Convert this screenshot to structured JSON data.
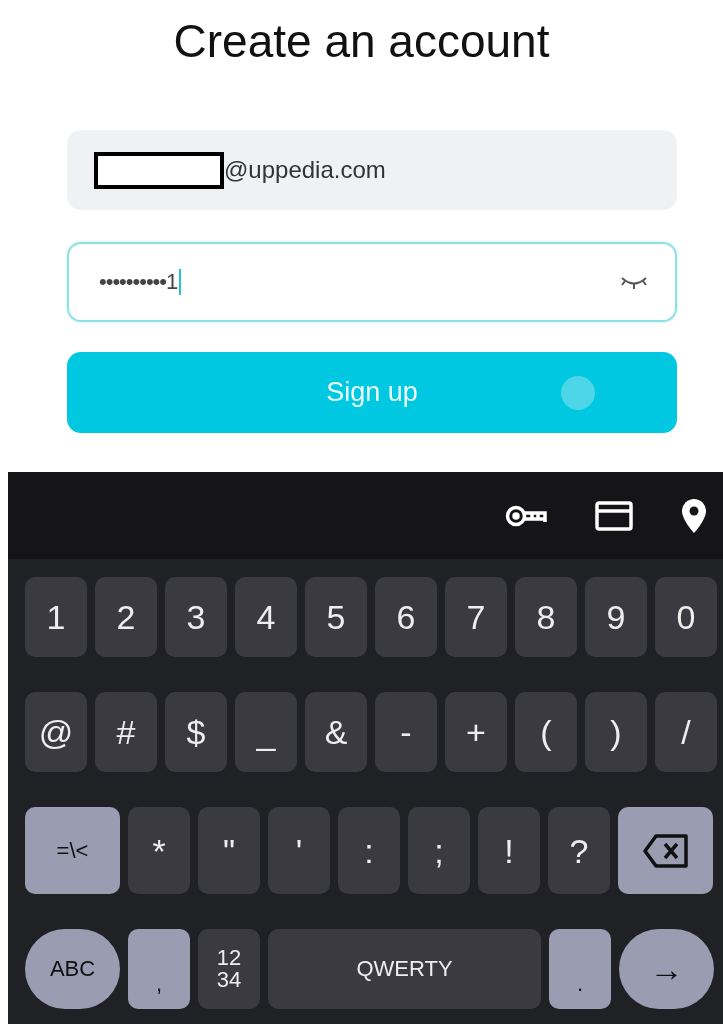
{
  "title": "Create an account",
  "email_field": {
    "value": "@uppedia.com"
  },
  "password_field": {
    "value": "••••••••••1"
  },
  "signup_button": {
    "label": "Sign up"
  },
  "keyboard": {
    "rows": [
      {
        "keys": [
          {
            "label": "1",
            "kind": "char"
          },
          {
            "label": "2",
            "kind": "char"
          },
          {
            "label": "3",
            "kind": "char"
          },
          {
            "label": "4",
            "kind": "char"
          },
          {
            "label": "5",
            "kind": "char"
          },
          {
            "label": "6",
            "kind": "char"
          },
          {
            "label": "7",
            "kind": "char"
          },
          {
            "label": "8",
            "kind": "char"
          },
          {
            "label": "9",
            "kind": "char"
          },
          {
            "label": "0",
            "kind": "char"
          }
        ]
      },
      {
        "keys": [
          {
            "label": "@",
            "kind": "char"
          },
          {
            "label": "#",
            "kind": "char"
          },
          {
            "label": "$",
            "kind": "char"
          },
          {
            "label": "_",
            "kind": "char"
          },
          {
            "label": "&",
            "kind": "char"
          },
          {
            "label": "-",
            "kind": "char"
          },
          {
            "label": "+",
            "kind": "char"
          },
          {
            "label": "(",
            "kind": "char"
          },
          {
            "label": ")",
            "kind": "char"
          },
          {
            "label": "/",
            "kind": "char"
          }
        ]
      },
      {
        "keys": [
          {
            "label": "=\\<",
            "kind": "mod"
          },
          {
            "label": "*",
            "kind": "char"
          },
          {
            "label": "\"",
            "kind": "char"
          },
          {
            "label": "'",
            "kind": "char"
          },
          {
            "label": ":",
            "kind": "char"
          },
          {
            "label": ";",
            "kind": "char"
          },
          {
            "label": "!",
            "kind": "char"
          },
          {
            "label": "?",
            "kind": "char"
          },
          {
            "kind": "backspace"
          }
        ]
      },
      {
        "keys": [
          {
            "label": "ABC",
            "kind": "round"
          },
          {
            "label": ",",
            "kind": "light"
          },
          {
            "lines": [
              "12",
              "34"
            ],
            "kind": "stack"
          },
          {
            "label": "QWERTY",
            "kind": "space"
          },
          {
            "label": ".",
            "kind": "light"
          },
          {
            "label": "→",
            "kind": "enter"
          }
        ]
      }
    ]
  }
}
